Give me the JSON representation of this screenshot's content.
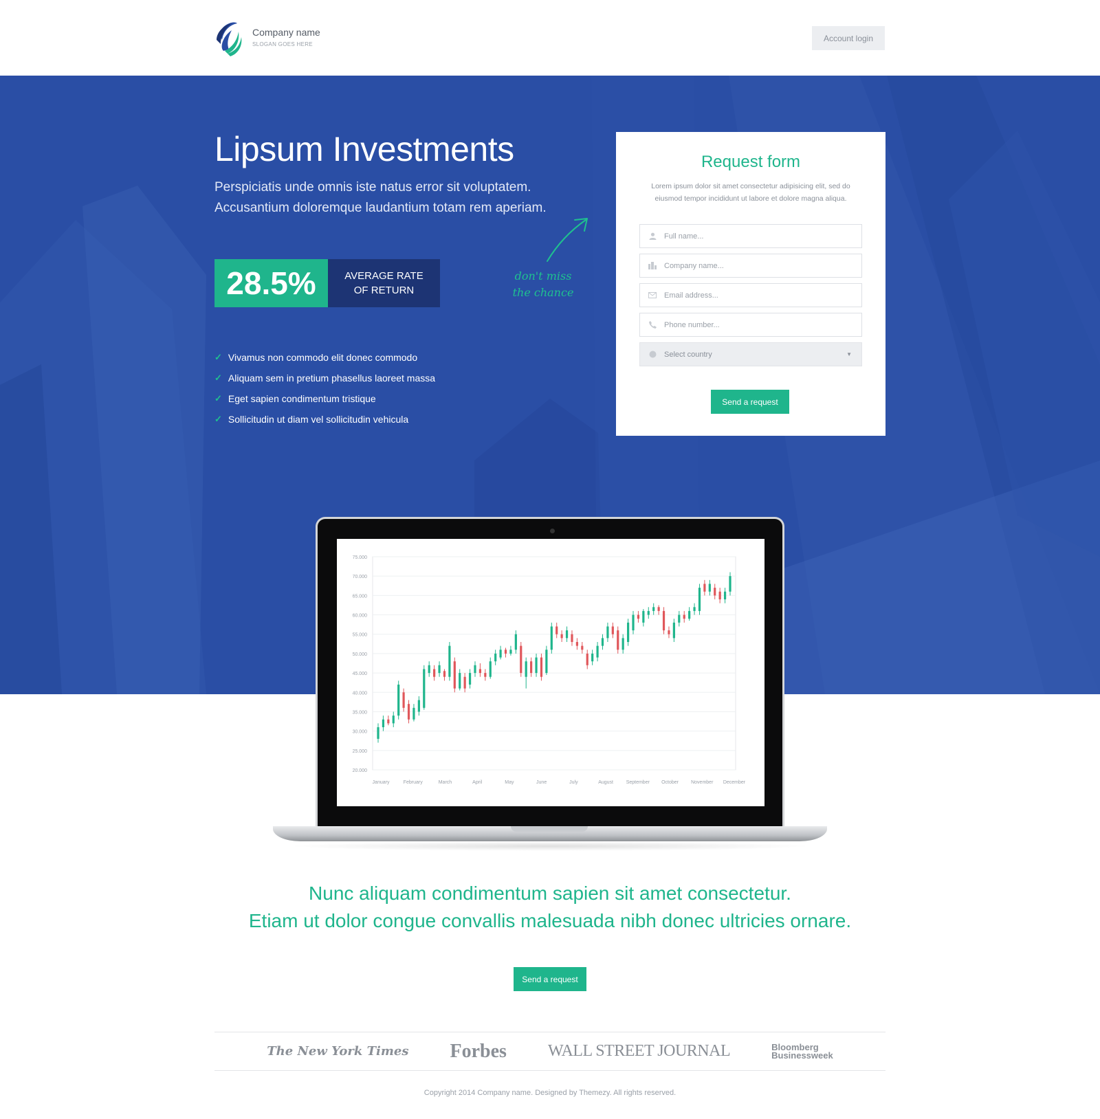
{
  "header": {
    "company_name": "Company name",
    "slogan": "SLOGAN GOES HERE",
    "login_label": "Account login"
  },
  "hero": {
    "title": "Lipsum Investments",
    "subtitle_line1": "Perspiciatis unde omnis iste natus error sit voluptatem.",
    "subtitle_line2": "Accusantium doloremque laudantium totam rem aperiam.",
    "rate_value": "28.5%",
    "rate_label_line1": "AVERAGE RATE",
    "rate_label_line2": "OF RETURN",
    "features": [
      "Vivamus non commodo elit donec commodo",
      "Aliquam sem in pretium phasellus laoreet massa",
      "Eget sapien condimentum tristique",
      "Sollicitudin ut diam vel sollicitudin vehicula"
    ],
    "note_line1": "don't miss",
    "note_line2": "the chance"
  },
  "form": {
    "title": "Request form",
    "description": "Lorem ipsum dolor sit amet consectetur adipisicing elit, sed do eiusmod tempor incididunt ut labore et dolore magna aliqua.",
    "fields": [
      {
        "placeholder": "Full name...",
        "icon": "user-icon"
      },
      {
        "placeholder": "Company name...",
        "icon": "building-icon"
      },
      {
        "placeholder": "Email address...",
        "icon": "envelope-icon"
      },
      {
        "placeholder": "Phone number...",
        "icon": "phone-icon"
      }
    ],
    "country_select": "Select country",
    "submit_label": "Send a request"
  },
  "chart_data": {
    "type": "candlestick",
    "x_labels": [
      "January",
      "February",
      "March",
      "April",
      "May",
      "June",
      "July",
      "August",
      "September",
      "October",
      "November",
      "December"
    ],
    "y_ticks": [
      "75.000",
      "70.000",
      "65.000",
      "60.000",
      "55.000",
      "50.000",
      "45.000",
      "40.000",
      "35.000",
      "30.000",
      "25.000",
      "20.000"
    ],
    "ylim": [
      20000,
      75000
    ],
    "grid": true,
    "up_color": "#1fb58c",
    "down_color": "#e0575b",
    "candles": [
      {
        "open": 28000,
        "close": 31000,
        "low": 27000,
        "high": 32000
      },
      {
        "open": 31000,
        "close": 33000,
        "low": 30000,
        "high": 34000
      },
      {
        "open": 33000,
        "close": 32000,
        "low": 31500,
        "high": 34000
      },
      {
        "open": 32000,
        "close": 34000,
        "low": 31000,
        "high": 35000
      },
      {
        "open": 34000,
        "close": 42000,
        "low": 33000,
        "high": 43000
      },
      {
        "open": 40000,
        "close": 36000,
        "low": 35000,
        "high": 41000
      },
      {
        "open": 37000,
        "close": 33000,
        "low": 32000,
        "high": 38000
      },
      {
        "open": 33000,
        "close": 36000,
        "low": 32500,
        "high": 37000
      },
      {
        "open": 35000,
        "close": 38000,
        "low": 34000,
        "high": 39000
      },
      {
        "open": 36000,
        "close": 46000,
        "low": 35500,
        "high": 47000
      },
      {
        "open": 45000,
        "close": 47000,
        "low": 44000,
        "high": 48000
      },
      {
        "open": 46000,
        "close": 44000,
        "low": 43000,
        "high": 47000
      },
      {
        "open": 45000,
        "close": 47000,
        "low": 44000,
        "high": 48000
      },
      {
        "open": 45500,
        "close": 44000,
        "low": 43000,
        "high": 46000
      },
      {
        "open": 44000,
        "close": 52000,
        "low": 43000,
        "high": 53000
      },
      {
        "open": 48000,
        "close": 41000,
        "low": 40000,
        "high": 49000
      },
      {
        "open": 41000,
        "close": 45000,
        "low": 40500,
        "high": 46000
      },
      {
        "open": 44000,
        "close": 41000,
        "low": 40000,
        "high": 45000
      },
      {
        "open": 42000,
        "close": 45000,
        "low": 41000,
        "high": 46000
      },
      {
        "open": 45000,
        "close": 47000,
        "low": 44000,
        "high": 48000
      },
      {
        "open": 46000,
        "close": 45000,
        "low": 44000,
        "high": 47500
      },
      {
        "open": 45000,
        "close": 44000,
        "low": 43000,
        "high": 46000
      },
      {
        "open": 44000,
        "close": 48000,
        "low": 43500,
        "high": 49000
      },
      {
        "open": 48000,
        "close": 50000,
        "low": 47000,
        "high": 51000
      },
      {
        "open": 49000,
        "close": 51000,
        "low": 48500,
        "high": 52000
      },
      {
        "open": 51000,
        "close": 50000,
        "low": 49000,
        "high": 51500
      },
      {
        "open": 50000,
        "close": 51000,
        "low": 49500,
        "high": 52000
      },
      {
        "open": 51000,
        "close": 55000,
        "low": 50000,
        "high": 56000
      },
      {
        "open": 52000,
        "close": 45000,
        "low": 44000,
        "high": 53000
      },
      {
        "open": 44000,
        "close": 48000,
        "low": 41000,
        "high": 49000
      },
      {
        "open": 48000,
        "close": 45000,
        "low": 44000,
        "high": 49000
      },
      {
        "open": 45000,
        "close": 49000,
        "low": 44000,
        "high": 50000
      },
      {
        "open": 49000,
        "close": 44000,
        "low": 43000,
        "high": 50000
      },
      {
        "open": 45000,
        "close": 51000,
        "low": 44500,
        "high": 52000
      },
      {
        "open": 51000,
        "close": 57000,
        "low": 50000,
        "high": 58000
      },
      {
        "open": 57000,
        "close": 55000,
        "low": 54000,
        "high": 58000
      },
      {
        "open": 55000,
        "close": 54000,
        "low": 53000,
        "high": 56000
      },
      {
        "open": 54000,
        "close": 56000,
        "low": 53000,
        "high": 57000
      },
      {
        "open": 55000,
        "close": 53000,
        "low": 52000,
        "high": 56000
      },
      {
        "open": 53000,
        "close": 52000,
        "low": 51000,
        "high": 54000
      },
      {
        "open": 52000,
        "close": 51000,
        "low": 50000,
        "high": 53000
      },
      {
        "open": 50000,
        "close": 47000,
        "low": 46000,
        "high": 51000
      },
      {
        "open": 48000,
        "close": 50000,
        "low": 47000,
        "high": 51000
      },
      {
        "open": 49000,
        "close": 52000,
        "low": 48000,
        "high": 53000
      },
      {
        "open": 52000,
        "close": 54000,
        "low": 51000,
        "high": 55000
      },
      {
        "open": 54000,
        "close": 57000,
        "low": 53000,
        "high": 58000
      },
      {
        "open": 57000,
        "close": 55000,
        "low": 54000,
        "high": 58000
      },
      {
        "open": 56000,
        "close": 51000,
        "low": 50000,
        "high": 57000
      },
      {
        "open": 51000,
        "close": 54000,
        "low": 50000,
        "high": 55000
      },
      {
        "open": 53000,
        "close": 58000,
        "low": 52000,
        "high": 59000
      },
      {
        "open": 56000,
        "close": 60000,
        "low": 55000,
        "high": 61000
      },
      {
        "open": 60000,
        "close": 59000,
        "low": 58000,
        "high": 61000
      },
      {
        "open": 58000,
        "close": 61000,
        "low": 57000,
        "high": 61500
      },
      {
        "open": 60000,
        "close": 61000,
        "low": 59000,
        "high": 62000
      },
      {
        "open": 61000,
        "close": 62000,
        "low": 60000,
        "high": 63000
      },
      {
        "open": 62000,
        "close": 61000,
        "low": 60000,
        "high": 62500
      },
      {
        "open": 61000,
        "close": 56000,
        "low": 55000,
        "high": 62000
      },
      {
        "open": 56000,
        "close": 55000,
        "low": 54000,
        "high": 57000
      },
      {
        "open": 54000,
        "close": 58000,
        "low": 53000,
        "high": 59000
      },
      {
        "open": 58000,
        "close": 60000,
        "low": 57000,
        "high": 61000
      },
      {
        "open": 60000,
        "close": 59000,
        "low": 58000,
        "high": 61000
      },
      {
        "open": 59000,
        "close": 61000,
        "low": 58500,
        "high": 62000
      },
      {
        "open": 61000,
        "close": 62000,
        "low": 60000,
        "high": 63000
      },
      {
        "open": 61000,
        "close": 67000,
        "low": 60000,
        "high": 68000
      },
      {
        "open": 68000,
        "close": 66000,
        "low": 65000,
        "high": 69000
      },
      {
        "open": 66000,
        "close": 68000,
        "low": 65000,
        "high": 69000
      },
      {
        "open": 67000,
        "close": 65000,
        "low": 64000,
        "high": 68000
      },
      {
        "open": 66000,
        "close": 64000,
        "low": 63000,
        "high": 67000
      },
      {
        "open": 64000,
        "close": 66000,
        "low": 63000,
        "high": 67000
      },
      {
        "open": 66000,
        "close": 70000,
        "low": 65000,
        "high": 71000
      }
    ]
  },
  "tagline": {
    "line1": "Nunc aliquam condimentum sapien sit amet consectetur.",
    "line2": "Etiam ut dolor congue convallis malesuada nibh donec ultricies ornare."
  },
  "cta_label": "Send a request",
  "press": {
    "nyt": "The New York Times",
    "forbes": "Forbes",
    "wsj": "WALL STREET JOURNAL",
    "bloomberg_line1": "Bloomberg",
    "bloomberg_line2": "Businessweek"
  },
  "footer": {
    "copyright": "Copyright 2014 Company name. Designed by Themezy. All rights reserved."
  },
  "colors": {
    "brand_blue": "#2a4ea5",
    "navy": "#1d3474",
    "accent_green": "#1fb58c",
    "candle_down": "#e0575b"
  }
}
